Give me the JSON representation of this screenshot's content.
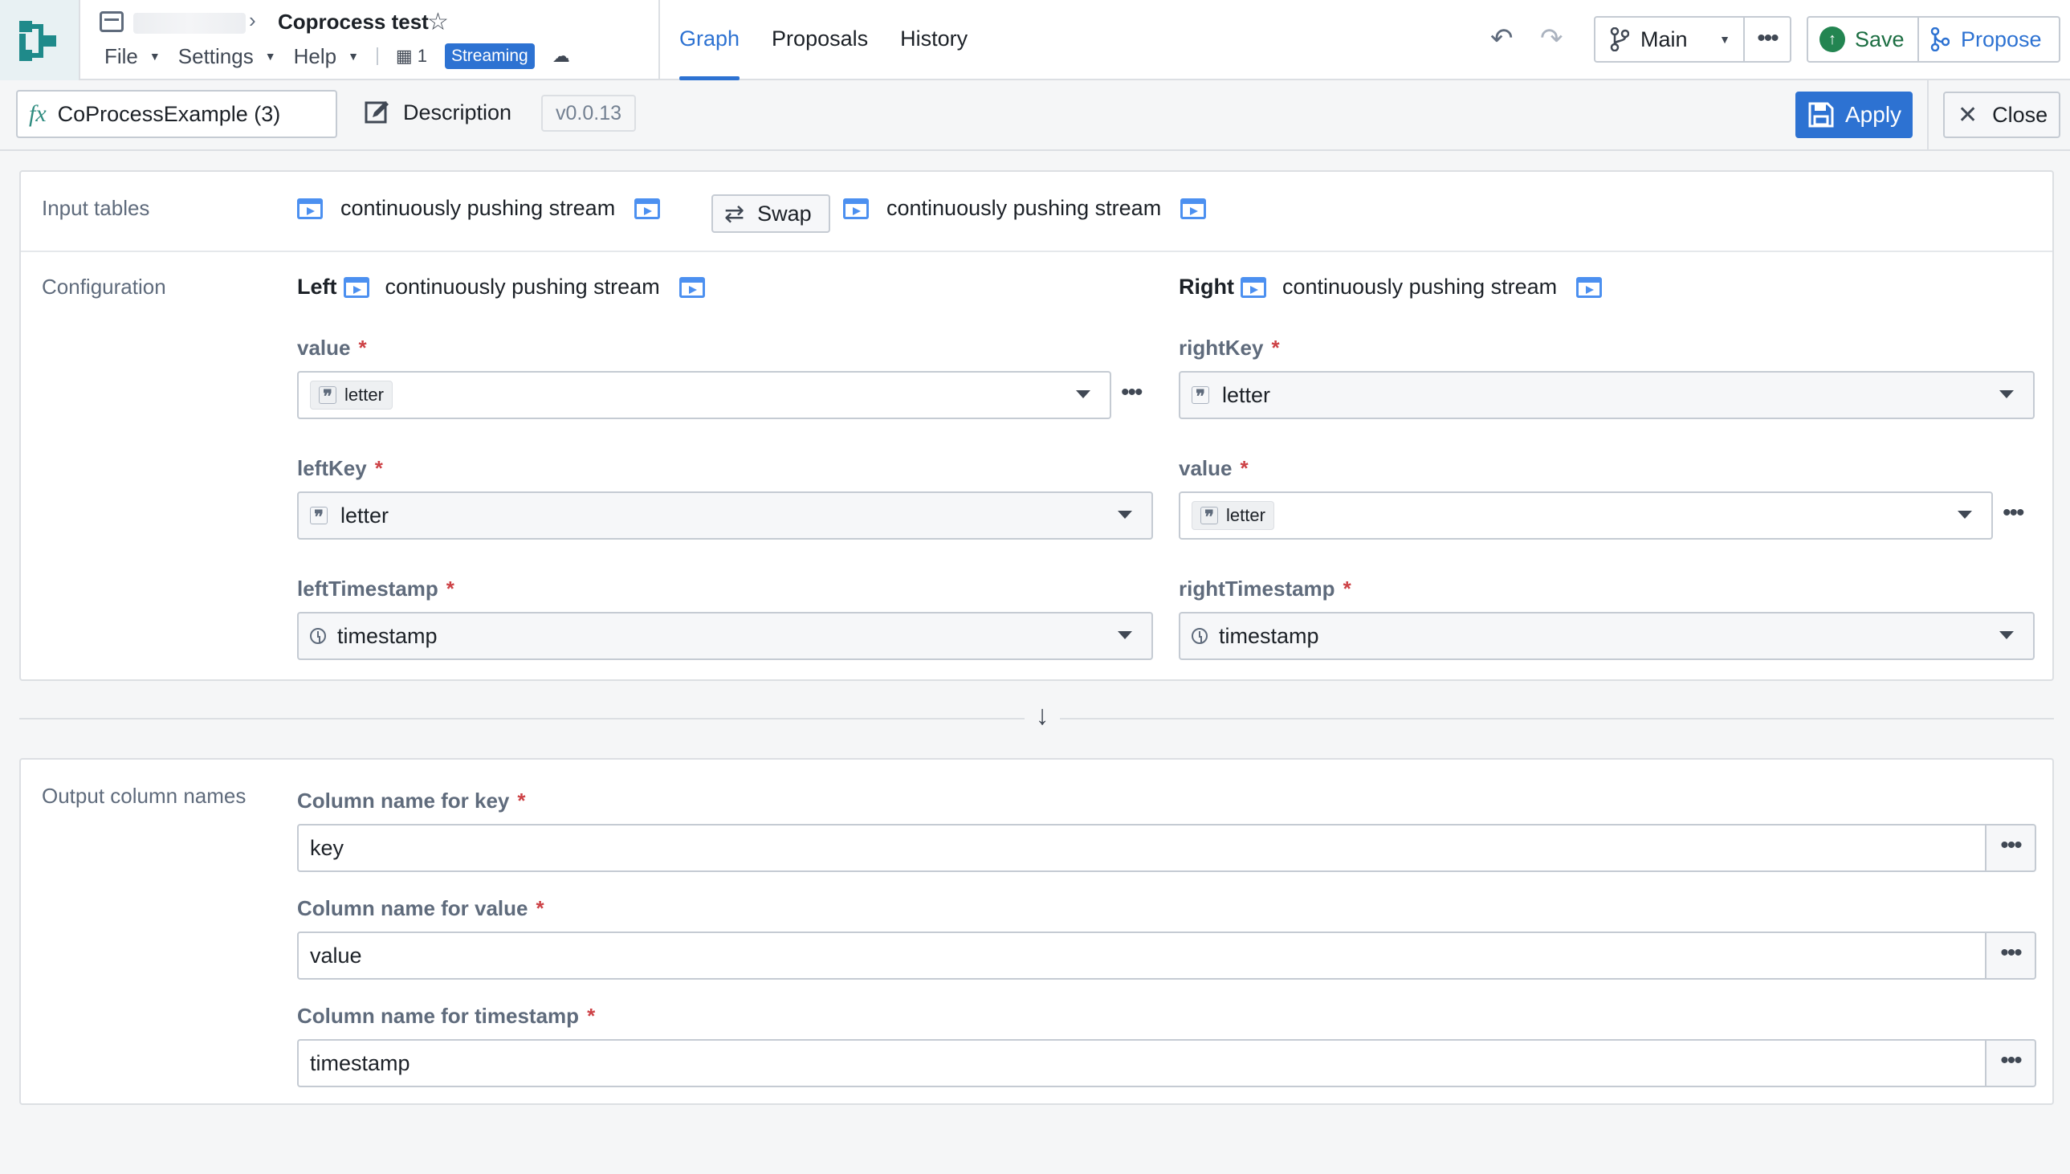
{
  "app": {
    "title": "Coprocess test",
    "menus": [
      "File",
      "Settings",
      "Help"
    ],
    "collaborators_count": "1",
    "mode_badge": "Streaming",
    "tabs": [
      "Graph",
      "Proposals",
      "History"
    ],
    "active_tab": "Graph",
    "branch": "Main",
    "save_label": "Save",
    "propose_label": "Propose"
  },
  "transform": {
    "name": "CoProcessExample (3)",
    "description_label": "Description",
    "version": "v0.0.13",
    "apply_label": "Apply",
    "close_label": "Close"
  },
  "input_tables": {
    "label": "Input tables",
    "left_table": "continuously pushing stream",
    "swap_label": "Swap",
    "right_table": "continuously pushing stream"
  },
  "configuration": {
    "label": "Configuration",
    "left": {
      "side_label": "Left",
      "table": "continuously pushing stream",
      "fields": [
        {
          "label": "value",
          "value": "letter"
        },
        {
          "label": "leftKey",
          "value": "letter"
        },
        {
          "label": "leftTimestamp",
          "value": "timestamp"
        }
      ]
    },
    "right": {
      "side_label": "Right",
      "table": "continuously pushing stream",
      "fields": [
        {
          "label": "rightKey",
          "value": "letter"
        },
        {
          "label": "value",
          "value": "letter"
        },
        {
          "label": "rightTimestamp",
          "value": "timestamp"
        }
      ]
    },
    "required_marker": "*"
  },
  "output": {
    "label": "Output column names",
    "fields": [
      {
        "label": "Column name for key",
        "value": "key"
      },
      {
        "label": "Column name for value",
        "value": "value"
      },
      {
        "label": "Column name for timestamp",
        "value": "timestamp"
      }
    ]
  },
  "icons": {
    "stream": "stream-table-icon",
    "string_type": "quote-icon",
    "timestamp_type": "clock-icon"
  },
  "colors": {
    "accent": "#2d72d2",
    "save_green": "#238551",
    "required": "#cd4246",
    "logo_teal": "#1f8a8a"
  }
}
